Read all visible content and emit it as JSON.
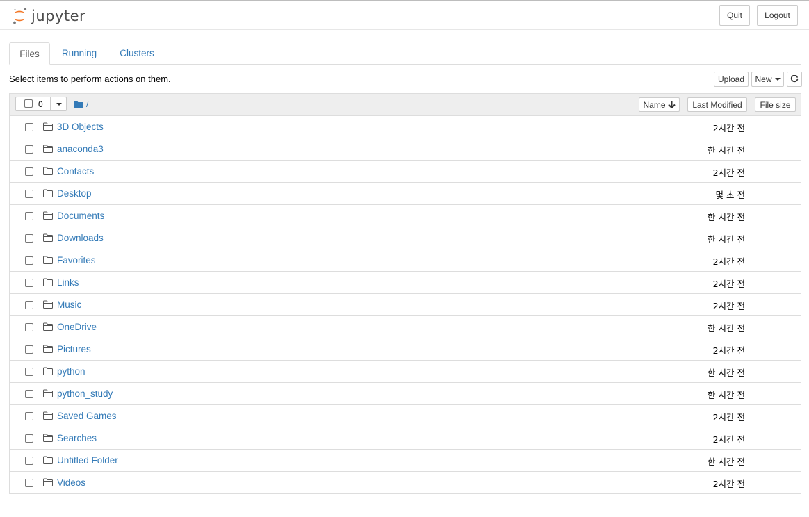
{
  "header": {
    "app_name": "jupyter",
    "quit_label": "Quit",
    "logout_label": "Logout"
  },
  "tabs": [
    {
      "label": "Files",
      "active": true
    },
    {
      "label": "Running",
      "active": false
    },
    {
      "label": "Clusters",
      "active": false
    }
  ],
  "toolbar": {
    "helper_text": "Select items to perform actions on them.",
    "upload_label": "Upload",
    "new_label": "New",
    "refresh_icon": "refresh-icon"
  },
  "list_header": {
    "selected_count": "0",
    "breadcrumb": "/",
    "sort_name_label": "Name",
    "sort_modified_label": "Last Modified",
    "sort_size_label": "File size"
  },
  "files": [
    {
      "name": "3D Objects",
      "modified": "2시간 전"
    },
    {
      "name": "anaconda3",
      "modified": "한 시간 전"
    },
    {
      "name": "Contacts",
      "modified": "2시간 전"
    },
    {
      "name": "Desktop",
      "modified": "몇 초 전"
    },
    {
      "name": "Documents",
      "modified": "한 시간 전"
    },
    {
      "name": "Downloads",
      "modified": "한 시간 전"
    },
    {
      "name": "Favorites",
      "modified": "2시간 전"
    },
    {
      "name": "Links",
      "modified": "2시간 전"
    },
    {
      "name": "Music",
      "modified": "2시간 전"
    },
    {
      "name": "OneDrive",
      "modified": "한 시간 전"
    },
    {
      "name": "Pictures",
      "modified": "2시간 전"
    },
    {
      "name": "python",
      "modified": "한 시간 전"
    },
    {
      "name": "python_study",
      "modified": "한 시간 전"
    },
    {
      "name": "Saved Games",
      "modified": "2시간 전"
    },
    {
      "name": "Searches",
      "modified": "2시간 전"
    },
    {
      "name": "Untitled Folder",
      "modified": "한 시간 전"
    },
    {
      "name": "Videos",
      "modified": "2시간 전"
    }
  ],
  "colors": {
    "link": "#337ab7",
    "logo_orange": "#f37726",
    "logo_gray": "#767677"
  }
}
